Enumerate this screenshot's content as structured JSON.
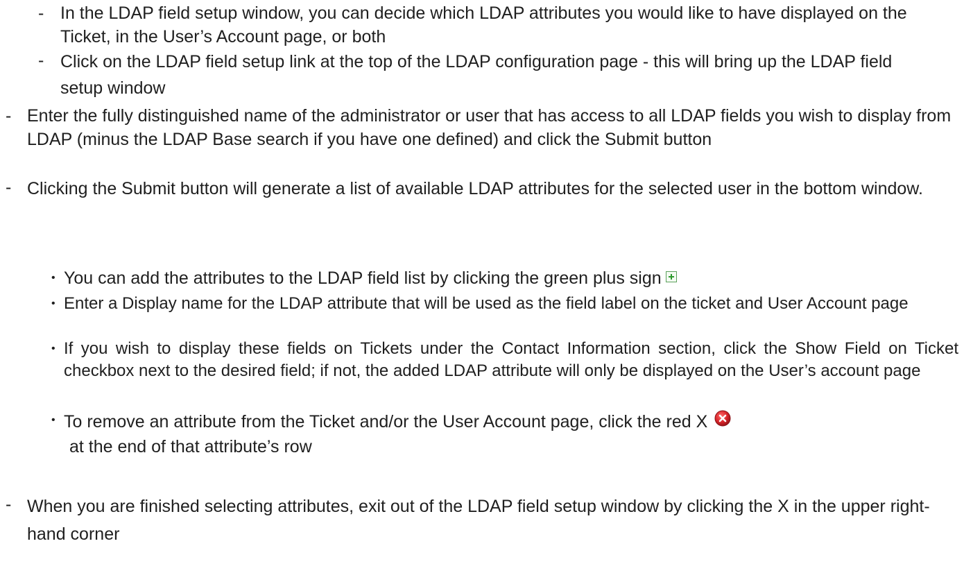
{
  "markers": {
    "dash": "-",
    "bullet": "•"
  },
  "sub_items": [
    {
      "text": "In the LDAP field setup window, you can decide which LDAP attributes you would like to have displayed on the Ticket, in the User’s Account page, or both"
    },
    {
      "text": "Click on the LDAP field setup link at the top of the LDAP configuration page - this will bring up the LDAP field setup window"
    }
  ],
  "main_items": [
    {
      "text": "Enter the fully distinguished name of the administrator or user that has access to all LDAP fields you wish to display from LDAP (minus the LDAP Base search if you have one defined) and click the Submit button"
    },
    {
      "text": "Clicking the Submit button will generate a list of available LDAP attributes for the selected user in the bottom window."
    }
  ],
  "bullets": [
    {
      "text": "You can add the attributes to the LDAP field list by clicking the green plus sign",
      "icon": "green-plus-icon"
    },
    {
      "text": "Enter a Display name for the LDAP attribute that will be used as the field label on the ticket and User Account page"
    },
    {
      "text": "If you wish to display these fields on Tickets under the Contact Information section, click the Show Field on Ticket checkbox next to the desired field; if not, the added LDAP attribute will only be displayed on the User’s account page"
    },
    {
      "text_before_icon": "To remove an attribute from the Ticket and/or the User Account page, click the red X",
      "text_after_icon": "at the end of that attribute’s row",
      "icon": "red-x-icon"
    }
  ],
  "final_item": {
    "text": "When you are finished selecting attributes, exit out of the LDAP field setup window by clicking the X in the upper right-hand corner"
  },
  "colors": {
    "text": "#1f1f1f",
    "plus_green": "#2d9a2d",
    "x_red": "#d9262b"
  }
}
